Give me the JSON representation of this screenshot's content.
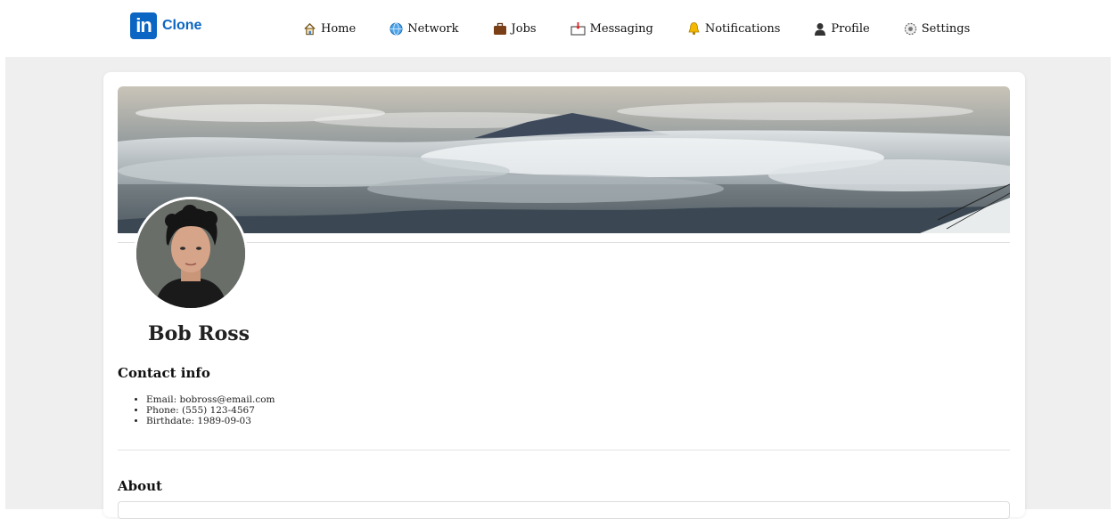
{
  "brand": {
    "logo_text": "in",
    "name": "Clone",
    "color": "#0a66c2"
  },
  "nav": {
    "items": [
      {
        "label": "Home",
        "icon": "home-icon"
      },
      {
        "label": "Network",
        "icon": "globe-icon"
      },
      {
        "label": "Jobs",
        "icon": "briefcase-icon"
      },
      {
        "label": "Messaging",
        "icon": "inbox-icon"
      },
      {
        "label": "Notifications",
        "icon": "bell-icon"
      },
      {
        "label": "Profile",
        "icon": "person-icon"
      },
      {
        "label": "Settings",
        "icon": "gear-icon"
      }
    ]
  },
  "profile": {
    "name": "Bob Ross",
    "banner": "mountain-clouds-banner",
    "avatar": "profile-photo"
  },
  "contact": {
    "title": "Contact info",
    "items": [
      "Email: bobross@email.com",
      "Phone: (555) 123-4567",
      "Birthdate: 1989-09-03"
    ]
  },
  "about": {
    "title": "About"
  }
}
